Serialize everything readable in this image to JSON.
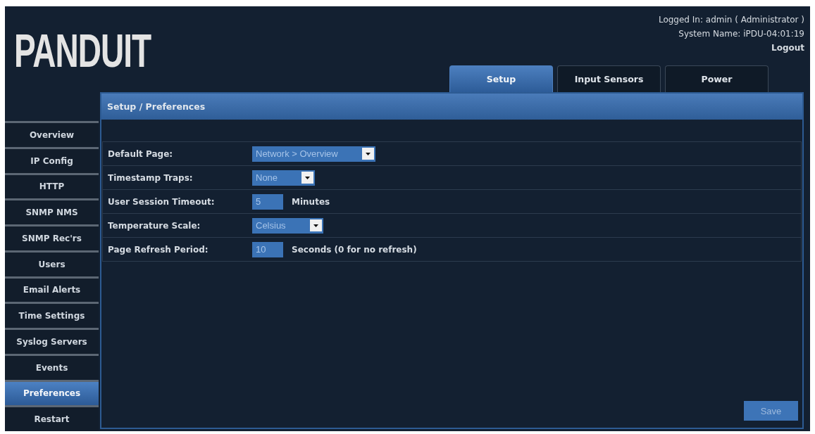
{
  "header": {
    "logo": "PANDUIT",
    "logged_in": "Logged In: admin ( Administrator )",
    "system_name": "System Name: iPDU-04:01:19",
    "logout": "Logout"
  },
  "tabs": [
    {
      "label": "Setup",
      "selected": true
    },
    {
      "label": "Input Sensors",
      "selected": false
    },
    {
      "label": "Power",
      "selected": false
    }
  ],
  "sidebar": {
    "items": [
      {
        "label": "Overview",
        "selected": false
      },
      {
        "label": "IP Config",
        "selected": false
      },
      {
        "label": "HTTP",
        "selected": false
      },
      {
        "label": "SNMP NMS",
        "selected": false
      },
      {
        "label": "SNMP Rec'rs",
        "selected": false
      },
      {
        "label": "Users",
        "selected": false
      },
      {
        "label": "Email Alerts",
        "selected": false
      },
      {
        "label": "Time Settings",
        "selected": false
      },
      {
        "label": "Syslog Servers",
        "selected": false
      },
      {
        "label": "Events",
        "selected": false
      },
      {
        "label": "Preferences",
        "selected": true
      },
      {
        "label": "Restart",
        "selected": false
      }
    ]
  },
  "panel": {
    "title": "Setup / Preferences",
    "fields": [
      {
        "kind": "select",
        "label": "Default Page:",
        "value": "Network > Overview"
      },
      {
        "kind": "select",
        "label": "Timestamp Traps:",
        "value": "None"
      },
      {
        "kind": "input",
        "label": "User Session Timeout:",
        "value": "5",
        "unit": "Minutes"
      },
      {
        "kind": "select",
        "label": "Temperature Scale:",
        "value": "Celsius"
      },
      {
        "kind": "input",
        "label": "Page Refresh Period:",
        "value": "10",
        "unit": "Seconds (0 for no refresh)"
      }
    ],
    "save_button": "Save"
  }
}
